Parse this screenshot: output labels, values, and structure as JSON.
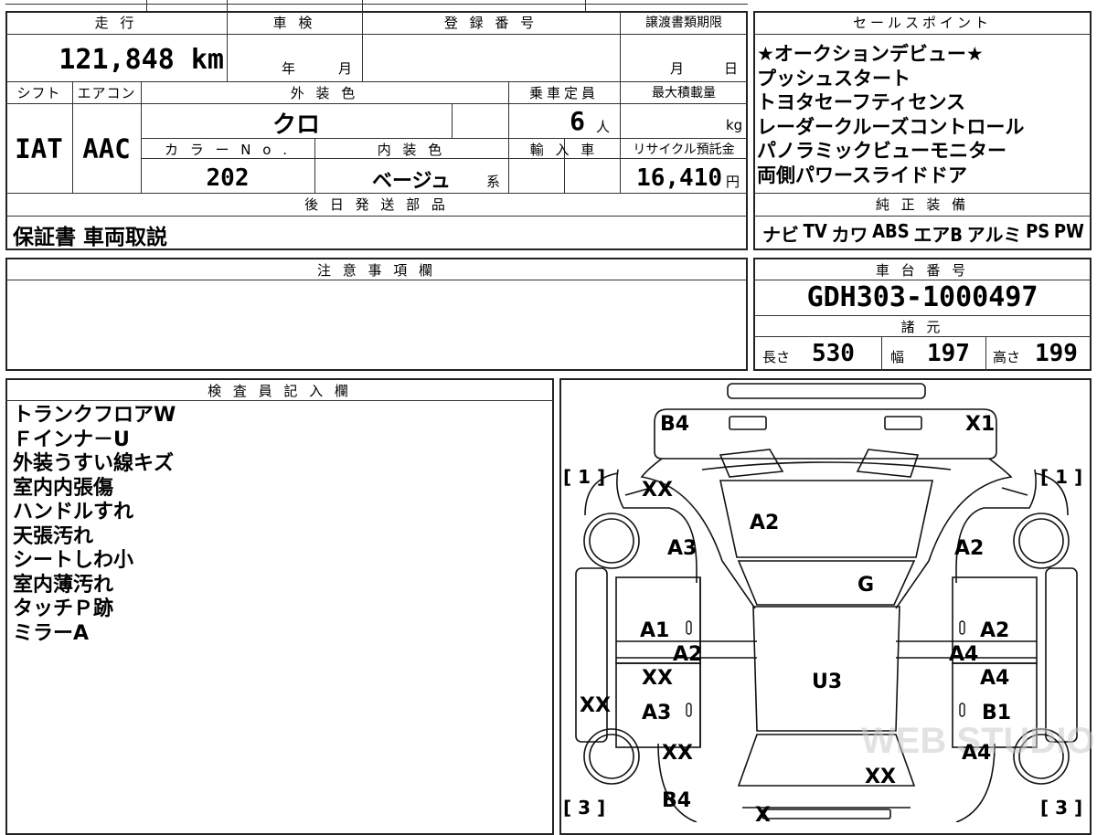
{
  "vehicle": {
    "mileage_label": "走 行",
    "mileage_value": "121,848",
    "mileage_unit": "km",
    "inspection_label": "車 検",
    "inspection_year": "年",
    "inspection_month": "月",
    "registration_label": "登 録 番 号",
    "transfer_label": "譲渡書類期限",
    "transfer_month": "月",
    "transfer_day": "日",
    "shift_label": "シフト",
    "shift_value": "IAT",
    "ac_label": "エアコン",
    "ac_value": "AAC",
    "exterior_label": "外 装 色",
    "exterior_value": "クロ",
    "capacity_label": "乗車定員",
    "capacity_value": "6",
    "capacity_unit": "人",
    "load_label": "最大積載量",
    "load_unit": "kg",
    "color_no_label": "カ ラ ー N o .",
    "color_no_value": "202",
    "interior_label": "内 装 色",
    "interior_value": "ベージュ",
    "interior_unit": "系",
    "import_label": "輸 入 車",
    "recycle_label": "リサイクル預託金",
    "recycle_value": "16,410",
    "recycle_unit": "円",
    "later_parts_label": "後 日 発 送 部 品",
    "later_parts_value": "保証書 車両取説"
  },
  "sales_points": {
    "label": "セールスポイント",
    "items": [
      "★オークションデビュー★",
      "プッシュスタート",
      "トヨタセーフティセンス",
      "レーダークルーズコントロール",
      "パノラミックビューモニター",
      "両側パワースライドドア"
    ]
  },
  "equipment": {
    "label": "純 正 装 備",
    "items": [
      "ナビ",
      "TV",
      "カワ",
      "ABS",
      "エアB",
      "アルミ",
      "PS",
      "PW"
    ]
  },
  "notes": {
    "label": "注 意 事 項 欄",
    "text": ""
  },
  "chassis": {
    "label": "車 台 番 号",
    "value": "GDH303-1000497"
  },
  "specs": {
    "label": "諸 元",
    "length_label": "長さ",
    "length_value": "530",
    "width_label": "幅",
    "width_value": "197",
    "height_label": "高さ",
    "height_value": "199"
  },
  "inspector": {
    "label": "検 査 員 記 入 欄",
    "items": [
      "トランクフロアW",
      "Ｆインナ－U",
      "外装うすい線キズ",
      "室内内張傷",
      "ハンドルすれ",
      "天張汚れ",
      "シートしわ小",
      "室内薄汚れ",
      "タッチＰ跡",
      "ミラーA"
    ]
  },
  "diagram": {
    "marks": {
      "b4_top": "B4",
      "x1": "X1",
      "xx_fl": "XX",
      "a2_hood": "A2",
      "a3_fl": "A3",
      "a2_fr": "A2",
      "g": "G",
      "a1": "A1",
      "a2_l": "A2",
      "a2_r": "A2",
      "a4_r": "A4",
      "xx_l": "XX",
      "u3": "U3",
      "a4_r2": "A4",
      "xx_side": "XX",
      "a3_l": "A3",
      "b1": "B1",
      "xx_rl": "XX",
      "a4_rr": "A4",
      "xx_rear": "XX",
      "b4_bottom": "B4",
      "x_bottom": "X",
      "zero_1": "0",
      "zero_2": "0",
      "zero_3": "0",
      "zero_4": "0"
    },
    "brackets": {
      "fl": "[ 1 ]",
      "fr": "[ 1 ]",
      "rl": "[ 3 ]",
      "rr": "[ 3 ]"
    },
    "watermark": "WEB STUDIO"
  }
}
